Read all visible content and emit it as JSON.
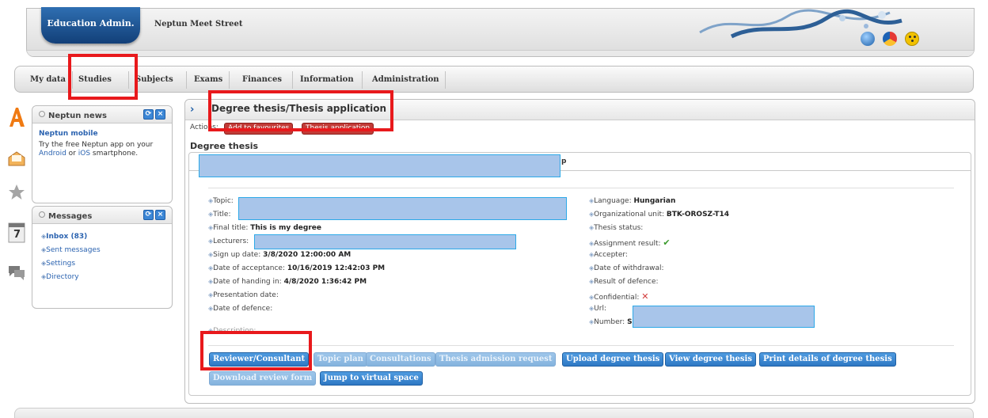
{
  "header": {
    "brand": "Education Admin.",
    "site_name": "Neptun Meet Street",
    "icons": [
      "globe-icon",
      "color-icon",
      "smile-icon"
    ]
  },
  "menu": {
    "items": [
      {
        "label": "My data"
      },
      {
        "label": "Studies"
      },
      {
        "label": "Subjects"
      },
      {
        "label": "Exams"
      },
      {
        "label": "Finances"
      },
      {
        "label": "Information"
      },
      {
        "label": "Administration"
      }
    ]
  },
  "news": {
    "title": "Neptun news",
    "heading": "Neptun mobile",
    "text_1": "Try the free Neptun app on your",
    "link_android": "Android",
    "text_or": " or ",
    "link_ios": "iOS",
    "text_2": " smartphone."
  },
  "messages": {
    "title": "Messages",
    "items": [
      {
        "label": "Inbox (83)"
      },
      {
        "label": "Sent messages"
      },
      {
        "label": "Settings"
      },
      {
        "label": "Directory"
      }
    ]
  },
  "main": {
    "title": "Degree thesis/Thesis application",
    "actions_label": "Actions:",
    "action_buttons": [
      {
        "label": "Add to favourites"
      },
      {
        "label": "Thesis application"
      }
    ],
    "section_title": "Degree thesis",
    "tab_tail": "p"
  },
  "details": {
    "left": [
      {
        "label": "Topic:",
        "value": ""
      },
      {
        "label": "Title:",
        "value": ""
      },
      {
        "label": "Final title:",
        "value": "This is my degree"
      },
      {
        "label": "Lecturers:",
        "value": ""
      },
      {
        "label": "Sign up date:",
        "value": "3/8/2020 12:00:00 AM"
      },
      {
        "label": "Date of acceptance:",
        "value": "10/16/2019 12:42:03 PM"
      },
      {
        "label": "Date of handing in:",
        "value": "4/8/2020 1:36:42 PM"
      },
      {
        "label": "Presentation date:",
        "value": ""
      },
      {
        "label": "Date of defence:",
        "value": ""
      },
      {
        "label": "Description:",
        "value": ""
      }
    ],
    "right": [
      {
        "label": "Language:",
        "value": "Hungarian"
      },
      {
        "label": "Organizational unit:",
        "value": "BTK-OROSZ-T14"
      },
      {
        "label": "Thesis status:",
        "value": ""
      },
      {
        "label": "Assignment result:",
        "value": "",
        "icon": "check-icon"
      },
      {
        "label": "Accepter:",
        "value": ""
      },
      {
        "label": "Date of withdrawal:",
        "value": ""
      },
      {
        "label": "Result of defence:",
        "value": ""
      },
      {
        "label": "Confidential:",
        "value": "",
        "icon": "x-icon"
      },
      {
        "label": "Url:",
        "value": ""
      },
      {
        "label": "Number:",
        "value": "S"
      }
    ]
  },
  "buttons": {
    "row1": [
      {
        "label": "Reviewer/Consultant",
        "enabled": true
      },
      {
        "label": "Topic plan",
        "enabled": false
      },
      {
        "label": "Consultations",
        "enabled": false
      },
      {
        "label": "Thesis admission request",
        "enabled": false
      },
      {
        "label": "Upload degree thesis",
        "enabled": true
      },
      {
        "label": "View degree thesis",
        "enabled": true
      },
      {
        "label": "Print details of degree thesis",
        "enabled": true
      }
    ],
    "row2": [
      {
        "label": "Download review form",
        "enabled": false
      },
      {
        "label": "Jump to virtual space",
        "enabled": true
      }
    ]
  },
  "colors": {
    "brand": "#1f5fa8",
    "highlight": "#e8191c",
    "redaction": "#a8c5ea"
  }
}
